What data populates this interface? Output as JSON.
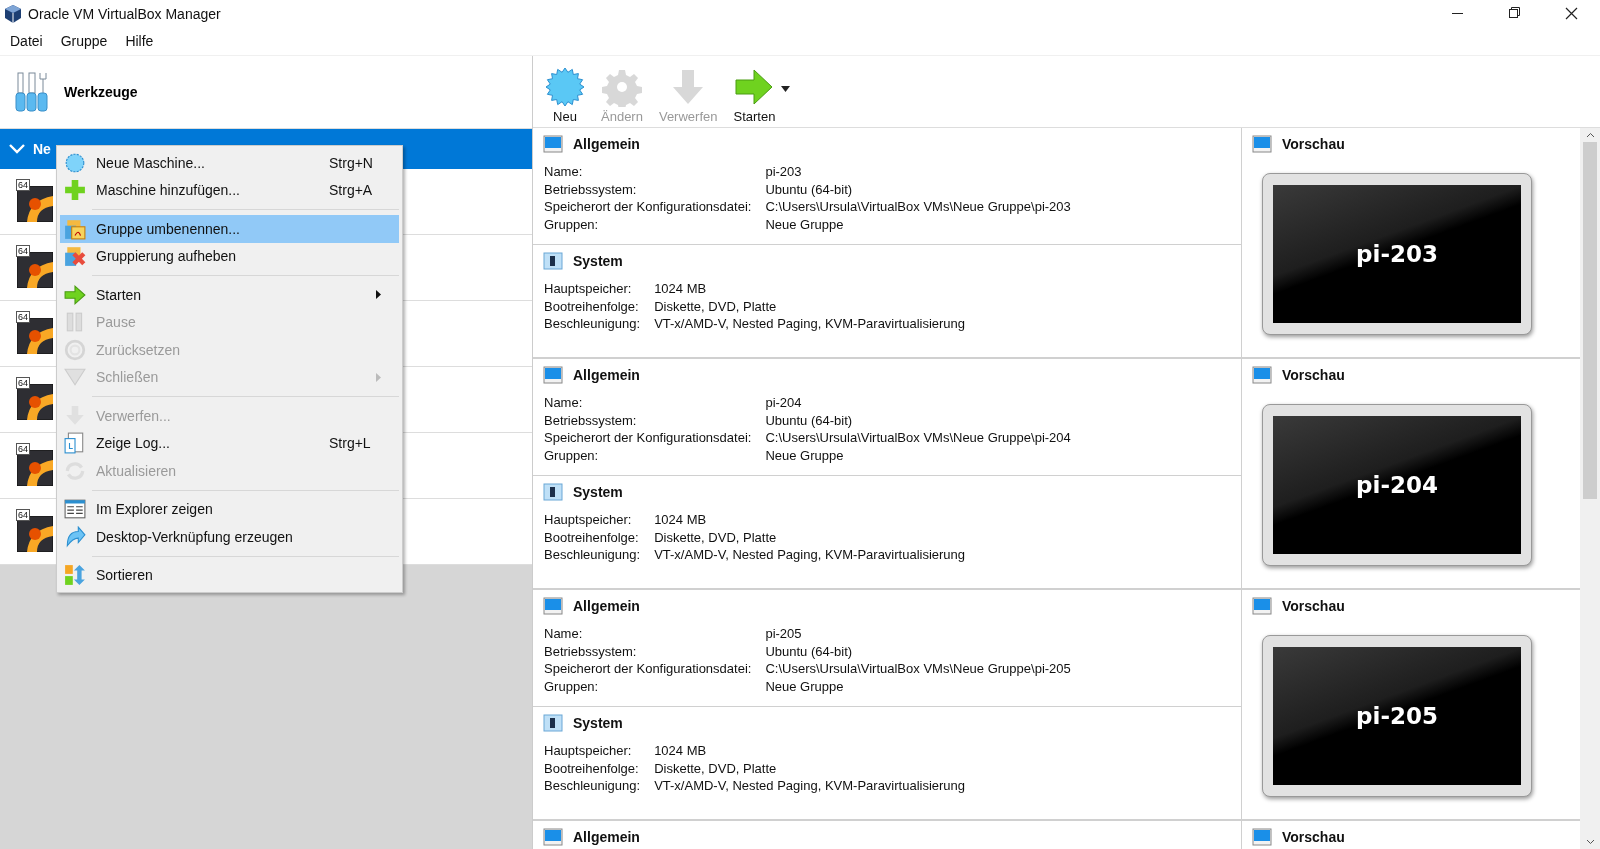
{
  "window": {
    "title": "Oracle VM VirtualBox Manager"
  },
  "menu_bar": [
    "Datei",
    "Gruppe",
    "Hilfe"
  ],
  "tools": {
    "label": "Werkzeuge"
  },
  "group": {
    "label": "Ne",
    "expanded": true,
    "selected": true
  },
  "machines": [
    {
      "badge": "64"
    },
    {
      "badge": "64"
    },
    {
      "badge": "64"
    },
    {
      "badge": "64"
    },
    {
      "badge": "64"
    },
    {
      "badge": "64"
    }
  ],
  "toolbar": [
    {
      "label": "Neu",
      "disabled": false
    },
    {
      "label": "Ändern",
      "disabled": true
    },
    {
      "label": "Verwerfen",
      "disabled": true
    },
    {
      "label": "Starten",
      "disabled": false
    }
  ],
  "context_menu": {
    "sections": [
      [
        {
          "label": "Neue Maschine...",
          "shortcut": "Strg+N",
          "disabled": false,
          "selected": false,
          "submenu": false
        },
        {
          "label": "Maschine hinzufügen...",
          "shortcut": "Strg+A",
          "disabled": false,
          "selected": false,
          "submenu": false
        }
      ],
      [
        {
          "label": "Gruppe umbenennen...",
          "disabled": false,
          "selected": true,
          "submenu": false
        },
        {
          "label": "Gruppierung aufheben",
          "disabled": false,
          "selected": false,
          "submenu": false
        }
      ],
      [
        {
          "label": "Starten",
          "disabled": false,
          "selected": false,
          "submenu": true
        },
        {
          "label": "Pause",
          "disabled": true,
          "selected": false,
          "submenu": false
        },
        {
          "label": "Zurücksetzen",
          "disabled": true,
          "selected": false,
          "submenu": false
        },
        {
          "label": "Schließen",
          "disabled": true,
          "selected": false,
          "submenu": true
        }
      ],
      [
        {
          "label": "Verwerfen...",
          "disabled": true,
          "selected": false,
          "submenu": false
        },
        {
          "label": "Zeige Log...",
          "shortcut": "Strg+L",
          "disabled": false,
          "selected": false,
          "submenu": false
        },
        {
          "label": "Aktualisieren",
          "disabled": true,
          "selected": false,
          "submenu": false
        }
      ],
      [
        {
          "label": "Im Explorer zeigen",
          "disabled": false,
          "selected": false,
          "submenu": false
        },
        {
          "label": "Desktop-Verknüpfung erzeugen",
          "disabled": false,
          "selected": false,
          "submenu": false
        }
      ],
      [
        {
          "label": "Sortieren",
          "disabled": false,
          "selected": false,
          "submenu": false
        }
      ]
    ]
  },
  "details": [
    {
      "general": {
        "title": "Allgemein",
        "rows": [
          {
            "label": "Name:",
            "value": "pi-203"
          },
          {
            "label": "Betriebssystem:",
            "value": "Ubuntu (64-bit)"
          },
          {
            "label": "Speicherort der Konfigurationsdatei:",
            "value": "C:\\Users\\Ursula\\VirtualBox VMs\\Neue Gruppe\\pi-203"
          },
          {
            "label": "Gruppen:",
            "value": "Neue Gruppe"
          }
        ]
      },
      "system": {
        "title": "System",
        "rows": [
          {
            "label": "Hauptspeicher:",
            "value": "1024 MB"
          },
          {
            "label": "Bootreihenfolge:",
            "value": "Diskette, DVD, Platte"
          },
          {
            "label": "Beschleunigung:",
            "value": "VT-x/AMD-V, Nested Paging, KVM-Paravirtualisierung"
          }
        ]
      },
      "preview": {
        "title": "Vorschau",
        "screen_text": "pi-203"
      }
    },
    {
      "general": {
        "title": "Allgemein",
        "rows": [
          {
            "label": "Name:",
            "value": "pi-204"
          },
          {
            "label": "Betriebssystem:",
            "value": "Ubuntu (64-bit)"
          },
          {
            "label": "Speicherort der Konfigurationsdatei:",
            "value": "C:\\Users\\Ursula\\VirtualBox VMs\\Neue Gruppe\\pi-204"
          },
          {
            "label": "Gruppen:",
            "value": "Neue Gruppe"
          }
        ]
      },
      "system": {
        "title": "System",
        "rows": [
          {
            "label": "Hauptspeicher:",
            "value": "1024 MB"
          },
          {
            "label": "Bootreihenfolge:",
            "value": "Diskette, DVD, Platte"
          },
          {
            "label": "Beschleunigung:",
            "value": "VT-x/AMD-V, Nested Paging, KVM-Paravirtualisierung"
          }
        ]
      },
      "preview": {
        "title": "Vorschau",
        "screen_text": "pi-204"
      }
    },
    {
      "general": {
        "title": "Allgemein",
        "rows": [
          {
            "label": "Name:",
            "value": "pi-205"
          },
          {
            "label": "Betriebssystem:",
            "value": "Ubuntu (64-bit)"
          },
          {
            "label": "Speicherort der Konfigurationsdatei:",
            "value": "C:\\Users\\Ursula\\VirtualBox VMs\\Neue Gruppe\\pi-205"
          },
          {
            "label": "Gruppen:",
            "value": "Neue Gruppe"
          }
        ]
      },
      "system": {
        "title": "System",
        "rows": [
          {
            "label": "Hauptspeicher:",
            "value": "1024 MB"
          },
          {
            "label": "Bootreihenfolge:",
            "value": "Diskette, DVD, Platte"
          },
          {
            "label": "Beschleunigung:",
            "value": "VT-x/AMD-V, Nested Paging, KVM-Paravirtualisierung"
          }
        ]
      },
      "preview": {
        "title": "Vorschau",
        "screen_text": "pi-205"
      }
    },
    {
      "general": {
        "title": "Allgemein"
      },
      "preview": {
        "title": "Vorschau"
      }
    }
  ]
}
